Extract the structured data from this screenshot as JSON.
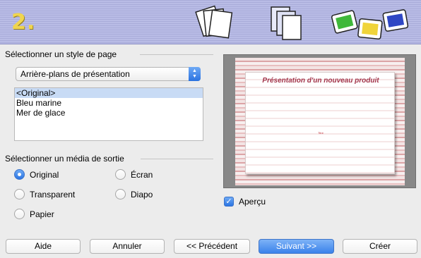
{
  "banner": {
    "step_number": "2.",
    "icons": [
      "page-stack-icon",
      "window-layers-icon",
      "color-slides-icon"
    ]
  },
  "page_style": {
    "title": "Sélectionner un style de page",
    "dropdown_value": "Arrière-plans de présentation",
    "list_items": [
      "<Original>",
      "Bleu marine",
      "Mer de glace"
    ],
    "selected_index": 0
  },
  "output_media": {
    "title": "Sélectionner un média de sortie",
    "options": [
      "Original",
      "Transparent",
      "Papier",
      "Écran",
      "Diapo"
    ],
    "selected": "Original"
  },
  "preview": {
    "slide_title": "Présentation d'un nouveau produit",
    "slide_subtitle": "Titre",
    "checkbox_label": "Aperçu",
    "checked": true
  },
  "buttons": {
    "help": "Aide",
    "cancel": "Annuler",
    "previous": "<< Précédent",
    "next": "Suivant >>",
    "create": "Créer"
  }
}
